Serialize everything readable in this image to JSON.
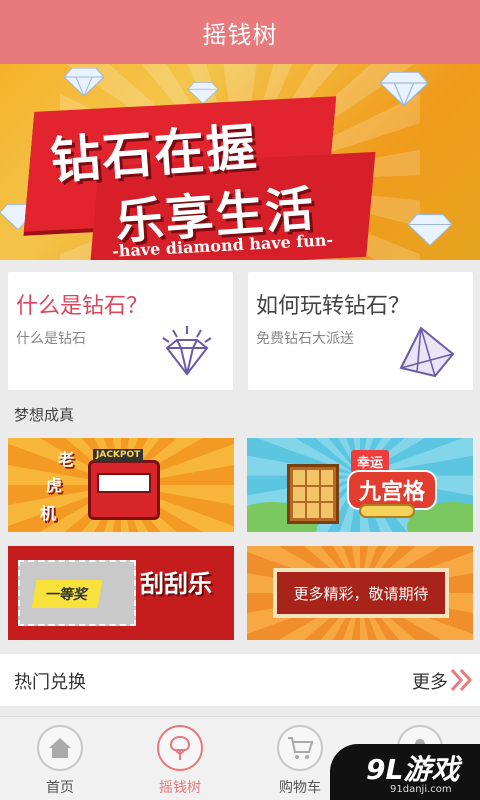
{
  "header": {
    "title": "摇钱树"
  },
  "hero": {
    "line1": "钻石在握",
    "line2": "乐享生活",
    "subtitle": "-have diamond have fun-"
  },
  "cards": [
    {
      "title": "什么是钻石？",
      "subtitle": "什么是钻石",
      "icon": "diamond-outline-icon"
    },
    {
      "title": "如何玩转钻石？",
      "subtitle": "免费钻石大派送",
      "icon": "diamond-solid-icon"
    }
  ],
  "section": {
    "title": "梦想成真"
  },
  "games": {
    "slot": {
      "jackpot": "JACKPOT",
      "words": [
        "老",
        "虎",
        "机"
      ]
    },
    "lucky": {
      "tag": "幸运",
      "title": "九宫格"
    },
    "scratch": {
      "prize": "一等奖",
      "title": "刮刮乐"
    },
    "more": {
      "text": "更多精彩，敬请期待"
    }
  },
  "hot": {
    "title": "热门兑换",
    "more": "更多"
  },
  "nav": [
    {
      "label": "首页",
      "icon": "home-icon",
      "active": false
    },
    {
      "label": "摇钱树",
      "icon": "tree-icon",
      "active": true
    },
    {
      "label": "购物车",
      "icon": "cart-icon",
      "active": false
    },
    {
      "label": "",
      "icon": "user-icon",
      "active": false
    }
  ],
  "watermark": {
    "logo": "9L游戏",
    "url": "91danji.com"
  },
  "colors": {
    "accent": "#e8797c",
    "pink_text": "#d9475a",
    "purple_icon": "#6b5aa8"
  }
}
